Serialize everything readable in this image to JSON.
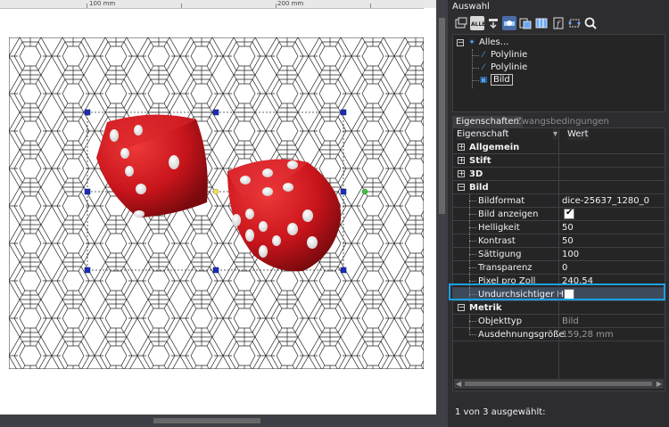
{
  "ruler": {
    "label_100": "100 mm",
    "label_200": "200 mm"
  },
  "panel": {
    "title": "Auswahl",
    "toolbar": [
      {
        "icon": "select-options-icon"
      },
      {
        "icon": "select-all-icon",
        "label": "ALLE"
      },
      {
        "icon": "filter-icon"
      },
      {
        "icon": "highlight-icon"
      },
      {
        "icon": "copy-icon"
      },
      {
        "icon": "columns-icon"
      },
      {
        "icon": "info-icon"
      },
      {
        "icon": "selection-frame-icon"
      },
      {
        "icon": "search-icon"
      }
    ],
    "tree": {
      "root": "Alles...",
      "children": [
        "Polylinie",
        "Polylinie",
        "Bild"
      ]
    },
    "tabs": {
      "active": "Eigenschaften",
      "inactive": "Zwangsbedingungen"
    },
    "grid": {
      "header_property": "Eigenschaft",
      "header_value": "Wert",
      "categories": {
        "allgemein": "Allgemein",
        "stift": "Stift",
        "d3": "3D",
        "bild": "Bild",
        "metrik": "Metrik"
      },
      "bild_props": [
        {
          "label": "Bildformat",
          "value": "dice-25637_1280_0"
        },
        {
          "label": "Bild anzeigen",
          "value": "",
          "checked": true
        },
        {
          "label": "Helligkeit",
          "value": "50"
        },
        {
          "label": "Kontrast",
          "value": "50"
        },
        {
          "label": "Sättigung",
          "value": "100"
        },
        {
          "label": "Transparenz",
          "value": "0"
        },
        {
          "label": "Pixel pro Zoll",
          "value": "240,54"
        },
        {
          "label": "Undurchsichtiger Hi...",
          "value": "",
          "checked": false
        }
      ],
      "metrik_props": [
        {
          "label": "Objekttyp",
          "value": "Bild"
        },
        {
          "label": "Ausdehnungsgröße",
          "value": "159,28 mm"
        }
      ]
    },
    "status": "1 von 3 ausgewählt:"
  },
  "colors": {
    "accent": "#1ba1e2",
    "dice": "#c8141b",
    "panel_bg": "#2d2d30"
  }
}
